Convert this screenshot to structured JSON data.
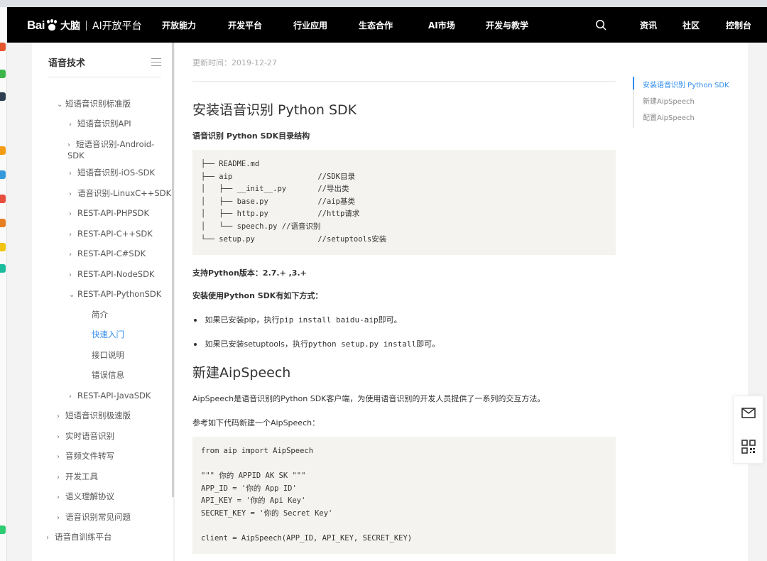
{
  "nav": {
    "logo": {
      "bai": "Bai",
      "du": "大脑",
      "divider": "|",
      "ai": "AI开放平台"
    },
    "items": [
      "开放能力",
      "开发平台",
      "行业应用",
      "生态合作",
      "AI市场",
      "开发与教学",
      "资讯",
      "社区",
      "控制台"
    ]
  },
  "sidebar": {
    "title": "语音技术",
    "items": [
      {
        "label": "短语音识别标准版",
        "arrow": "⌄"
      },
      {
        "label": "短语音识别API",
        "arrow": "›"
      },
      {
        "label": "短语音识别-Android-SDK",
        "arrow": "›"
      },
      {
        "label": "短语音识别-iOS-SDK",
        "arrow": "›"
      },
      {
        "label": "语音识别-LinuxC++SDK",
        "arrow": "›"
      },
      {
        "label": "REST-API-PHPSDK",
        "arrow": "›"
      },
      {
        "label": "REST-API-C++SDK",
        "arrow": "›"
      },
      {
        "label": "REST-API-C#SDK",
        "arrow": "›"
      },
      {
        "label": "REST-API-NodeSDK",
        "arrow": "›"
      },
      {
        "label": "REST-API-PythonSDK",
        "arrow": "⌄"
      },
      {
        "label": "简介"
      },
      {
        "label": "快速入门"
      },
      {
        "label": "接口说明"
      },
      {
        "label": "错误信息"
      },
      {
        "label": "REST-API-JavaSDK",
        "arrow": "›"
      },
      {
        "label": "短语音识别极速版",
        "arrow": "›"
      },
      {
        "label": "实时语音识别",
        "arrow": "›"
      },
      {
        "label": "音频文件转写",
        "arrow": "›"
      },
      {
        "label": "开发工具",
        "arrow": "›"
      },
      {
        "label": "语义理解协议",
        "arrow": "›"
      },
      {
        "label": "语音识别常见问题",
        "arrow": "›"
      },
      {
        "label": "语音自训练平台",
        "arrow": "›"
      }
    ]
  },
  "main": {
    "updated": "更新时间：2019-12-27",
    "section1_title": "安装语音识别 Python SDK",
    "dir_heading": "语音识别 Python SDK目录结构",
    "dir_tree": [
      "├── README.md",
      "├── aip                   //SDK目录",
      "│   ├── __init__.py       //导出类",
      "│   ├── base.py           //aip基类",
      "│   ├── http.py           //http请求",
      "│   └── speech.py //语音识别",
      "└── setup.py              //setuptools安装"
    ],
    "py_version": "支持Python版本：2.7.+ ,3.+",
    "install_heading": "安装使用Python SDK有如下方式：",
    "bullet1_pre": "如果已安装pip，执行",
    "bullet1_code": "pip install baidu-aip",
    "bullet1_post": "即可。",
    "bullet2_pre": "如果已安装setuptools，执行",
    "bullet2_code": "python setup.py install",
    "bullet2_post": "即可。",
    "section2_title": "新建AipSpeech",
    "aipspeech_desc": "AipSpeech是语音识别的Python SDK客户端，为使用语音识别的开发人员提供了一系列的交互方法。",
    "ref_text": "参考如下代码新建一个AipSpeech：",
    "code2": [
      "from aip import AipSpeech",
      "",
      "\"\"\" 你的 APPID AK SK \"\"\"",
      "APP_ID = '你的 App ID'",
      "API_KEY = '你的 Api Key'",
      "SECRET_KEY = '你的 Secret Key'",
      "",
      "client = AipSpeech(APP_ID, API_KEY, SECRET_KEY)"
    ]
  },
  "toc": {
    "items": [
      "安装语音识别 Python SDK",
      "新建AipSpeech",
      "配置AipSpeech"
    ]
  },
  "colors": {
    "accent": "#2d8cf0",
    "nav_bg": "#000000",
    "code_bg": "#f4f3f0"
  }
}
